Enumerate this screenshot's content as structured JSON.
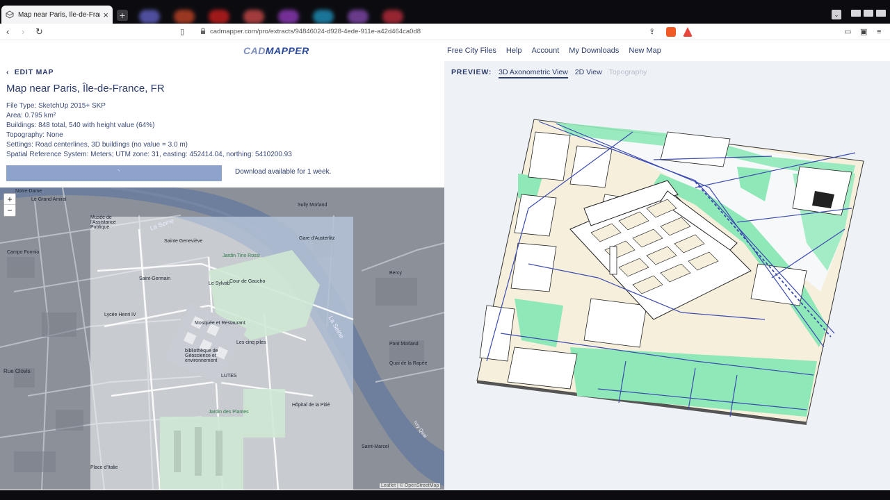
{
  "browser": {
    "tab_title": "Map near Paris, Île-de-France, FR",
    "tab_close": "×",
    "new_tab": "+",
    "url": "cadmapper.com/pro/extracts/94846024-d928-4ede-911e-a42d464ca0d8"
  },
  "header": {
    "logo_cad": "CAD",
    "logo_mapper": "MAPPER",
    "nav": [
      "Free City Files",
      "Help",
      "Account",
      "My Downloads",
      "New Map"
    ]
  },
  "left": {
    "edit_map": "EDIT MAP",
    "title": "Map near Paris, Île-de-France, FR",
    "meta": [
      "File Type: SketchUp 2015+ SKP",
      "Area: 0.795 km²",
      "Buildings: 848 total, 540 with height value (64%)",
      "Topography: None",
      "Settings: Road centerlines, 3D buildings (no value = 3.0 m)",
      "Spatial Reference System: Meters; UTM zone: 31, easting: 452414.04, northing: 5410200.93"
    ],
    "download_note": "Download available for 1 week."
  },
  "map": {
    "zoom_in": "+",
    "zoom_out": "−",
    "attribution": "Leaflet | © OpenStreetMap",
    "labels": [
      "Notre-Dame",
      "Le Grand Amiral",
      "Musée de l'Assistance Publique",
      "Sainte Geneviève",
      "La Seine",
      "Sully Morland",
      "Jardin Tino Rossi",
      "Saint-Germain",
      "Le Sylvab",
      "Cour de Gaucho",
      "Mosquée et Restaurant",
      "Les cinq piles",
      "bibliothèque de Géoscience et environnement",
      "LUTES",
      "Jardin des Plantes",
      "La Seine",
      "Ivry Quai",
      "Bercy",
      "Campo Formio",
      "Pont Morland",
      "Quai de la Rapée",
      "Gare d'Austerlitz",
      "Hôpital de la Pitié",
      "Saint-Marcel",
      "Place d'Italie",
      "Rue Clovis",
      "Lycée Henri IV"
    ]
  },
  "preview": {
    "label": "PREVIEW:",
    "tabs": [
      "3D Axonometric View",
      "2D View",
      "Topography"
    ]
  },
  "colors": {
    "accent": "#2b3b6b",
    "progress": "#8da3cc",
    "park": "#8fe8b8",
    "water": "#f4f6f8",
    "ground": "#f6efdc",
    "road": "#3b4bb0"
  }
}
